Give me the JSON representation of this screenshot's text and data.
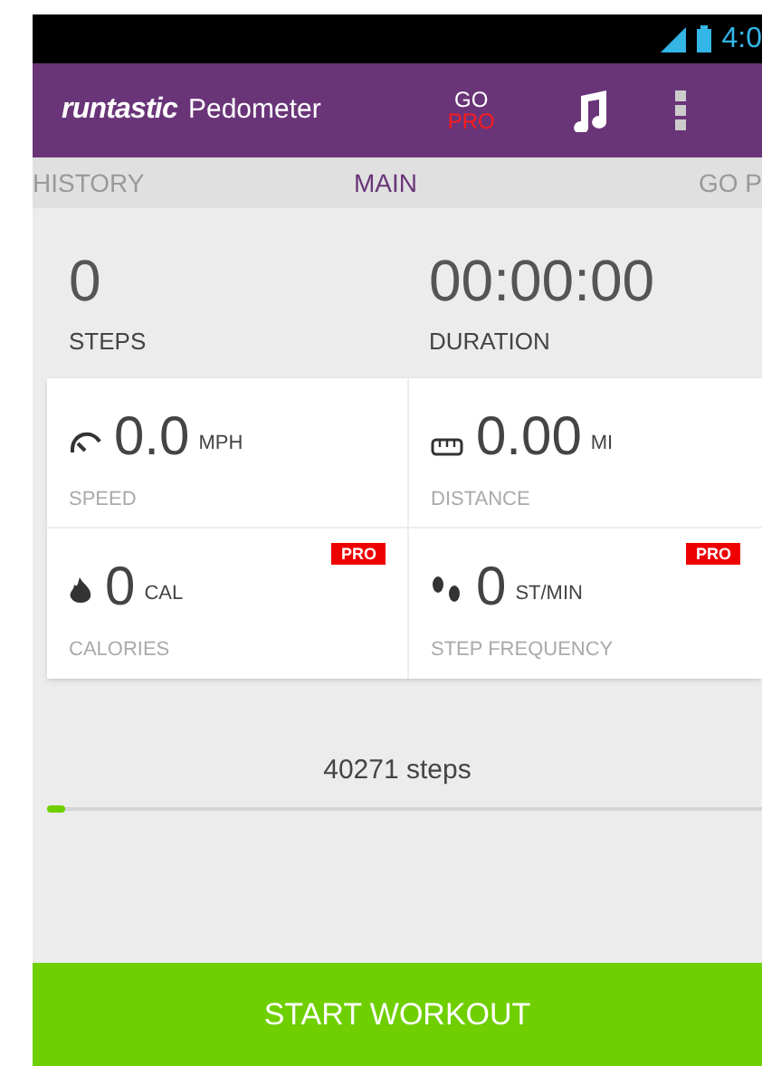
{
  "status_bar": {
    "time": "4:0"
  },
  "toolbar": {
    "logo": "runtastic",
    "title": "Pedometer",
    "go": "GO",
    "pro": "PRO"
  },
  "tabs": [
    {
      "label": "HISTORY",
      "selected": false
    },
    {
      "label": "MAIN",
      "selected": true
    },
    {
      "label": "GO P",
      "selected": false
    }
  ],
  "summary": [
    {
      "value": "0",
      "label": "STEPS"
    },
    {
      "value": "00:00:00",
      "label": "DURATION"
    }
  ],
  "metrics": [
    {
      "kind": "speed",
      "value": "0.0",
      "unit": "MPH",
      "label": "SPEED"
    },
    {
      "kind": "distance",
      "value": "0.00",
      "unit": "MI",
      "label": "DISTANCE"
    },
    {
      "kind": "calories",
      "value": "0",
      "unit": "CAL",
      "label": "CALORIES",
      "badge": "PRO"
    },
    {
      "kind": "frequency",
      "value": "0",
      "unit": "ST/MIN",
      "label": "STEP FREQUENCY",
      "badge": "PRO"
    }
  ],
  "goal": {
    "text": "40271 steps",
    "level": 0.025
  },
  "start_button": "START WORKOUT"
}
